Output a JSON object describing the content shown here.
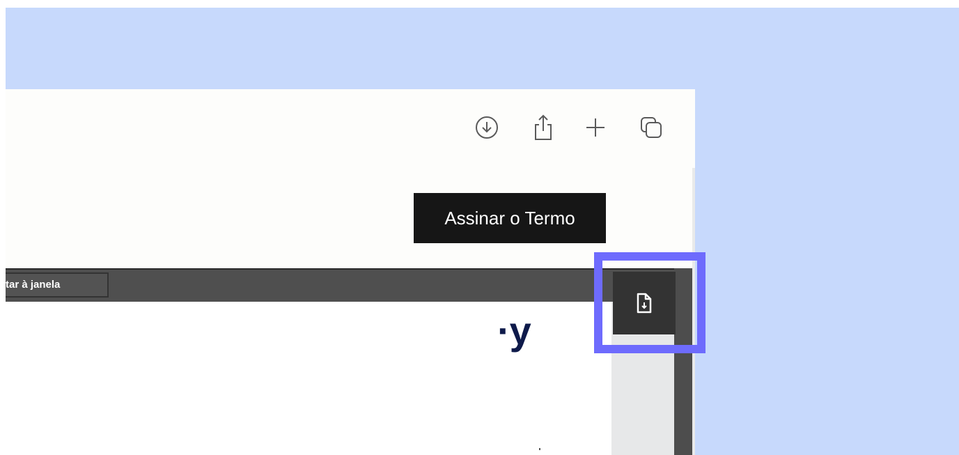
{
  "browser_toolbar": {
    "icons": [
      "download-circle-icon",
      "share-icon",
      "plus-icon",
      "tabs-icon"
    ]
  },
  "tooltip": {
    "text": "Assinar o Termo"
  },
  "viewer": {
    "fit_button_label": "tar à janela",
    "download_icon": "file-download-icon"
  },
  "document": {
    "logo_text": "·y"
  },
  "colors": {
    "background": "#c7d9fc",
    "highlight": "#6e6bfd",
    "viewer_toolbar": "#4f4f4f",
    "logo": "#0e1a4a"
  }
}
